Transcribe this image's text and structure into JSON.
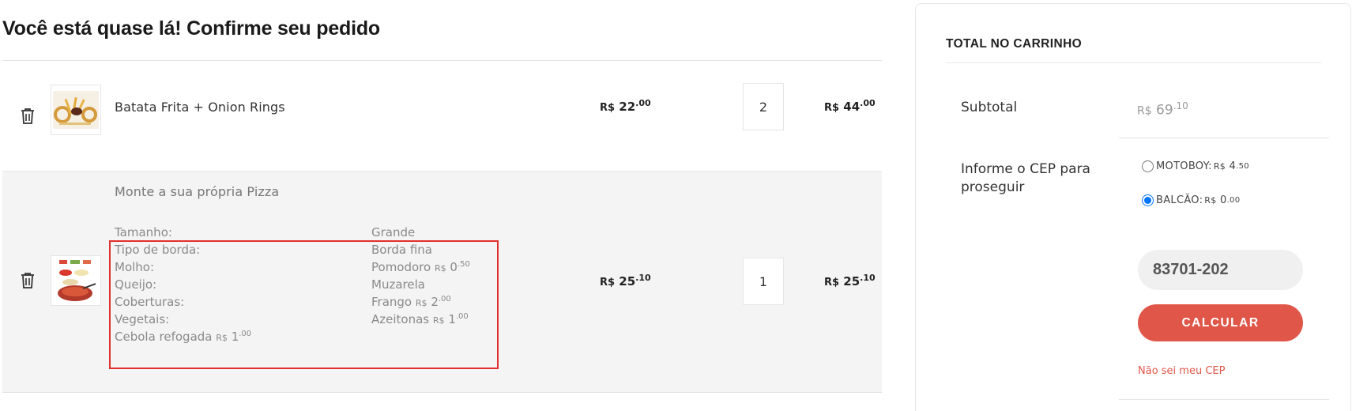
{
  "page": {
    "title": "Você está quase lá! Confirme seu pedido"
  },
  "cart": {
    "items": [
      {
        "name": "Batata Frita + Onion Rings",
        "unit_price": {
          "currency": "R$",
          "int": "22",
          "dec": ".00"
        },
        "quantity": "2",
        "total_price": {
          "currency": "R$",
          "int": "44",
          "dec": ".00"
        }
      },
      {
        "name": "Monte a sua própria Pizza",
        "unit_price": {
          "currency": "R$",
          "int": "25",
          "dec": ".10"
        },
        "quantity": "1",
        "total_price": {
          "currency": "R$",
          "int": "25",
          "dec": ".10"
        },
        "options": [
          {
            "label": "Tamanho:",
            "value": "Grande"
          },
          {
            "label": "Tipo de borda:",
            "value": "Borda fina"
          },
          {
            "label": "Molho:",
            "value": "Pomodoro",
            "cur": "R$",
            "int": "0",
            "dec": ".50"
          },
          {
            "label": "Queijo:",
            "value": "Muzarela"
          },
          {
            "label": "Coberturas:",
            "value": "Frango",
            "cur": "R$",
            "int": "2",
            "dec": ".00"
          },
          {
            "label": "Vegetais:",
            "value": "Azeitonas",
            "cur": "R$",
            "int": "1",
            "dec": ".00"
          },
          {
            "label": "Cebola refogada",
            "cur": "R$",
            "int": "1",
            "dec": ".00"
          }
        ]
      }
    ]
  },
  "summary": {
    "title": "TOTAL NO CARRINHO",
    "subtotal_label": "Subtotal",
    "subtotal": {
      "currency": "R$",
      "int": "69",
      "dec": ".10"
    },
    "cep_label": "Informe o CEP para proseguir",
    "shipping": [
      {
        "label": "MOTOBOY:",
        "cur": "R$",
        "int": "4",
        "dec": ".50",
        "selected": false
      },
      {
        "label": "BALCÃO:",
        "cur": "R$",
        "int": "0",
        "dec": ".00",
        "selected": true
      }
    ],
    "cep_value": "83701-202",
    "calc_button": "CALCULAR",
    "cep_link": "Não sei meu CEP"
  },
  "colors": {
    "accent": "#e0574a",
    "highlight_box": "#e0302b",
    "row_alt_bg": "#f4f4f4"
  },
  "icons": {
    "remove": "trash-icon"
  }
}
